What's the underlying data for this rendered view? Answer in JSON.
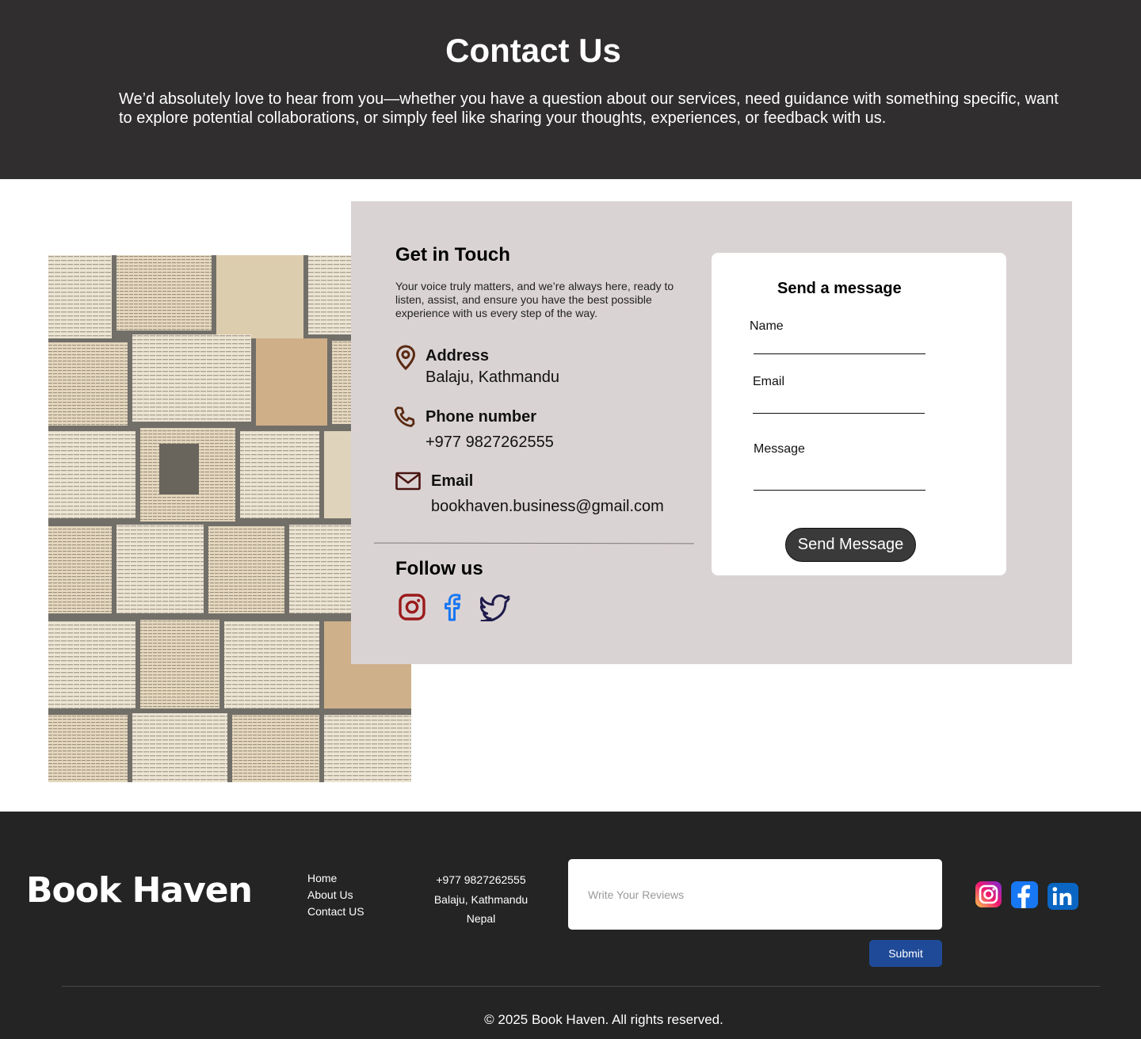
{
  "hero": {
    "title": "Contact Us",
    "text": "We’d absolutely love to hear from you—whether you have a question about our services, need guidance with something specific, want to explore potential collaborations, or simply feel like sharing your thoughts, experiences, or feedback with us."
  },
  "contact": {
    "title": "Get in Touch",
    "description": "Your voice truly matters, and we’re always here, ready to listen, assist, and ensure you have the best possible experience with us every step of the way.",
    "address_label": "Address",
    "address_value": "Balaju, Kathmandu",
    "phone_label": "Phone number",
    "phone_value": "+977 9827262555",
    "email_label": "Email",
    "email_value": "bookhaven.business@gmail.com",
    "follow_title": "Follow us"
  },
  "form": {
    "title": "Send a message",
    "name_label": "Name",
    "email_label": "Email",
    "message_label": "Message",
    "button": "Send Message"
  },
  "footer": {
    "brand": "Book Haven",
    "links": [
      "Home",
      "About Us",
      "Contact US"
    ],
    "phone": "+977 9827262555",
    "address_line1": "Balaju, Kathmandu",
    "address_line2": "Nepal",
    "review_placeholder": "Write Your Reviews",
    "submit": "Submit",
    "copyright": "© 2025 Book Haven. All rights reserved."
  },
  "icons": {
    "address": "location-pin-icon",
    "phone": "phone-icon",
    "email": "envelope-icon",
    "social": [
      "instagram-icon",
      "facebook-icon",
      "twitter-icon"
    ],
    "footer_social": [
      "instagram-icon",
      "facebook-icon",
      "linkedin-icon"
    ]
  },
  "colors": {
    "hero_bg": "#302e2f",
    "panel_bg": "#dad3d4",
    "footer_bg": "#242424",
    "submit_bg": "#1f4a98",
    "pin_brown": "#5a2a12",
    "instagram_red": "#9b1a1a",
    "facebook_blue": "#1877f2",
    "twitter_navy": "#1e1b4b"
  }
}
